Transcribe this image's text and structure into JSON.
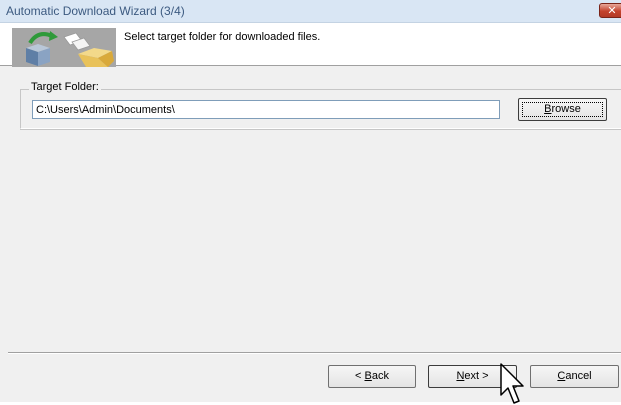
{
  "window": {
    "title": "Automatic Download Wizard (3/4)",
    "close_glyph": "✕"
  },
  "header": {
    "instruction": "Select target folder for downloaded files.",
    "image_icon": "download-folder-icon"
  },
  "target_folder": {
    "label": "Target Folder:",
    "path_value": "C:\\Users\\Admin\\Documents\\",
    "browse_prefix": "",
    "browse_mnemonic": "B",
    "browse_rest": "rowse"
  },
  "footer": {
    "back_prefix": "< ",
    "back_mnemonic": "B",
    "back_rest": "ack",
    "next_prefix": "",
    "next_mnemonic": "N",
    "next_rest": "ext >",
    "cancel_prefix": "",
    "cancel_mnemonic": "C",
    "cancel_rest": "ancel"
  },
  "colors": {
    "titlebar": "#d9e6f4",
    "title_text": "#3c5a80",
    "dialog_bg": "#f0f0f0",
    "close_button": "#c4432d"
  }
}
